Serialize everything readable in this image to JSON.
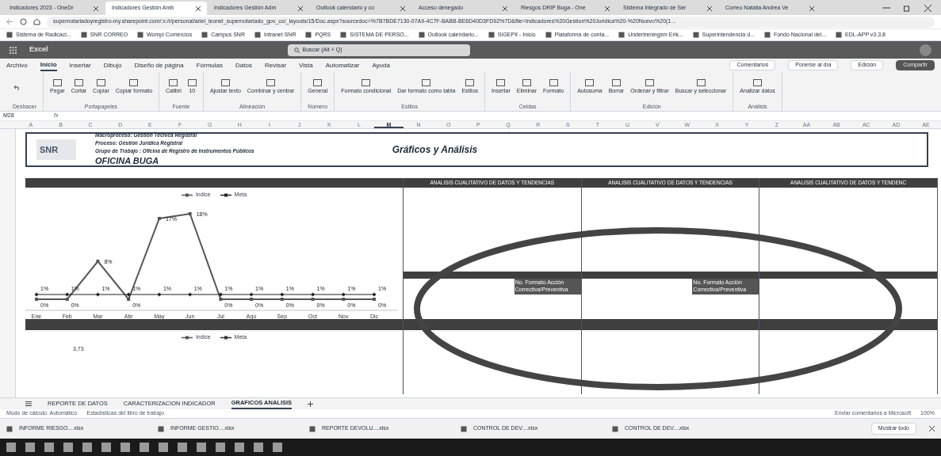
{
  "browser_tabs": [
    {
      "title": "Indicadores 2023 - OneDr",
      "selected": false
    },
    {
      "title": "Indicadores Gestión Amb",
      "selected": true
    },
    {
      "title": "Indicadores Gestión Adm",
      "selected": false
    },
    {
      "title": "Outlook calendario y co",
      "selected": false
    },
    {
      "title": "Acceso denegado",
      "selected": false
    },
    {
      "title": "Riesgos DRIP Buga - One",
      "selected": false
    },
    {
      "title": "Sistema Integrado de Ser",
      "selected": false
    },
    {
      "title": "Correo Natalia Andrea Ve",
      "selected": false
    }
  ],
  "address": "supernotariadoyregistro-my.sharepoint.com/:x:/r/personal/ariel_leonel_supernotariado_gov_co/_layouts/15/Doc.aspx?sourcedoc=%7B7BDE7130-07A9-4C7F-BABB-BE6D40D3FD92%7D&file=Indicadores%20Gestion%20Juridica%20-%20Nuevo%20(1...",
  "bookmarks": [
    "Sistema de Radicaci...",
    "SNR CORREO",
    "Wompi Comercios",
    "Campus SNR",
    "Intranet SNR",
    "PQRS",
    "SISTEMA DE PERSO...",
    "Outlook calendario...",
    "SIGEPII - Inicio",
    "Plataforma de conta...",
    "Undertreningsm Erik...",
    "Superintendencia d...",
    "Fondo Nacional del...",
    "EDL-APP v3.3.8"
  ],
  "app_header": {
    "app": "Excel",
    "search": "Buscar (Alt + Q)"
  },
  "ribbon_tabs": [
    {
      "label": "Archivo",
      "selected": false
    },
    {
      "label": "Inicio",
      "selected": true
    },
    {
      "label": "Insertar",
      "selected": false
    },
    {
      "label": "Dibujo",
      "selected": false
    },
    {
      "label": "Diseño de página",
      "selected": false
    },
    {
      "label": "Fórmulas",
      "selected": false
    },
    {
      "label": "Datos",
      "selected": false
    },
    {
      "label": "Revisar",
      "selected": false
    },
    {
      "label": "Vista",
      "selected": false
    },
    {
      "label": "Automatizar",
      "selected": false
    },
    {
      "label": "Ayuda",
      "selected": false
    }
  ],
  "ribbon_actions": [
    "Comentarios",
    "Ponerse al día",
    "Edición",
    "Compartir"
  ],
  "ribbon_groups": [
    {
      "label": "Deshacer"
    },
    {
      "label": "Portapapeles",
      "items": [
        "Pegar",
        "Cortar",
        "Copiar",
        "Copiar formato"
      ]
    },
    {
      "label": "Fuente",
      "items": [
        "Calibri",
        "10"
      ]
    },
    {
      "label": "Alineación",
      "items": [
        "Ajustar texto",
        "Combinar y centrar"
      ]
    },
    {
      "label": "Número",
      "items": [
        "General"
      ]
    },
    {
      "label": "Estilos",
      "items": [
        "Formato condicional",
        "Dar formato como tabla",
        "Estilos"
      ]
    },
    {
      "label": "Celdas",
      "items": [
        "Insertar",
        "Eliminar",
        "Formato"
      ]
    },
    {
      "label": "Edición",
      "items": [
        "Autosuma",
        "Borrar",
        "Ordenar y filtrar",
        "Buscar y seleccionar"
      ]
    },
    {
      "label": "Análisis",
      "items": [
        "Analizar datos"
      ]
    }
  ],
  "name_box": "M28",
  "function_label": "fx",
  "columns": [
    {
      "label": "A",
      "selected": false
    },
    {
      "label": "B",
      "selected": false
    },
    {
      "label": "C",
      "selected": false
    },
    {
      "label": "D",
      "selected": false
    },
    {
      "label": "E",
      "selected": false
    },
    {
      "label": "F",
      "selected": false
    },
    {
      "label": "G",
      "selected": false
    },
    {
      "label": "H",
      "selected": false
    },
    {
      "label": "I",
      "selected": false
    },
    {
      "label": "J",
      "selected": false
    },
    {
      "label": "K",
      "selected": false
    },
    {
      "label": "L",
      "selected": false
    },
    {
      "label": "M",
      "selected": true
    },
    {
      "label": "N",
      "selected": false
    },
    {
      "label": "O",
      "selected": false
    },
    {
      "label": "P",
      "selected": false
    },
    {
      "label": "Q",
      "selected": false
    },
    {
      "label": "R",
      "selected": false
    },
    {
      "label": "S",
      "selected": false
    },
    {
      "label": "T",
      "selected": false
    },
    {
      "label": "U",
      "selected": false
    },
    {
      "label": "V",
      "selected": false
    },
    {
      "label": "W",
      "selected": false
    },
    {
      "label": "X",
      "selected": false
    },
    {
      "label": "Y",
      "selected": false
    },
    {
      "label": "Z",
      "selected": false
    },
    {
      "label": "AA",
      "selected": false
    },
    {
      "label": "AB",
      "selected": false
    },
    {
      "label": "AC",
      "selected": false
    },
    {
      "label": "AD",
      "selected": false
    },
    {
      "label": "AE",
      "selected": false
    }
  ],
  "sheet_header": {
    "logo": "SNR",
    "lines": [
      "Macroproceso: Gestión Técnica Registral",
      "Proceso: Gestión Jurídica Registral",
      "Grupo de Trabajo : Oficina de Registro de Instrumentos Públicos"
    ],
    "office": "OFICINA BUGA",
    "title": "Gráficos y Análisis"
  },
  "analysis_headers": [
    "ANALISIS CUALITATIVO DE DATOS Y TENDENCIAS",
    "ANALISIS CUALITATIVO DE DATOS Y TENDENCIAS",
    "ANALISIS CUALITATIVO DE DATOS Y TENDENC"
  ],
  "action_notes": [
    "No. Formato Acción Correctiva/Preventiva",
    "No. Formato Acción Correctiva/Preventiva"
  ],
  "chart": {
    "chart_data": {
      "type": "line",
      "categories": [
        "Ene",
        "Feb",
        "Mar",
        "Abr",
        "May",
        "Jun",
        "Jul",
        "Ago",
        "Sep",
        "Oct",
        "Nov",
        "Dic"
      ],
      "series": [
        {
          "name": "Indice",
          "color": "#555555",
          "marker": "square",
          "values": [
            0,
            0,
            8,
            0,
            17,
            18,
            0,
            0,
            0,
            0,
            0,
            0
          ],
          "value_labels": [
            "0%",
            "0%",
            "8%",
            "0%",
            "17%",
            "18%",
            "0%",
            "0%",
            "0%",
            "0%",
            "0%",
            "0%"
          ]
        },
        {
          "name": "Meta",
          "color": "#222222",
          "marker": "diamond",
          "values": [
            1,
            1,
            1,
            1,
            1,
            1,
            1,
            1,
            1,
            1,
            1,
            1
          ],
          "value_labels": [
            "1%",
            "1%",
            "1%",
            "1%",
            "1%",
            "1%",
            "1%",
            "1%",
            "1%",
            "1%",
            "1%",
            "1%"
          ]
        }
      ],
      "data_labels": true
    }
  },
  "chart2": {
    "legend": [
      "Indice",
      "Meta"
    ],
    "value": "3,73"
  },
  "sheet_tabs": [
    {
      "label": "REPORTE DE DATOS",
      "selected": false
    },
    {
      "label": "CARACTERIZACION INDICADOR",
      "selected": false
    },
    {
      "label": "GRAFICOS ANALISIS",
      "selected": true
    }
  ],
  "status_bar": {
    "left": [
      "Modo de cálculo: Automático",
      "Estadísticas del libro de trabajo"
    ],
    "feedback": "Enviar comentarios a Microsoft",
    "zoom": "100%"
  },
  "downloads": [
    "INFORME RIESGO....xlsx",
    "INFORME GESTIO....xlsx",
    "REPORTE DEVOLU....xlsx",
    "CONTROL DE DEV....xlsx",
    "CONTROL DE DEV....xlsx"
  ],
  "show_all": "Mostrar todo"
}
